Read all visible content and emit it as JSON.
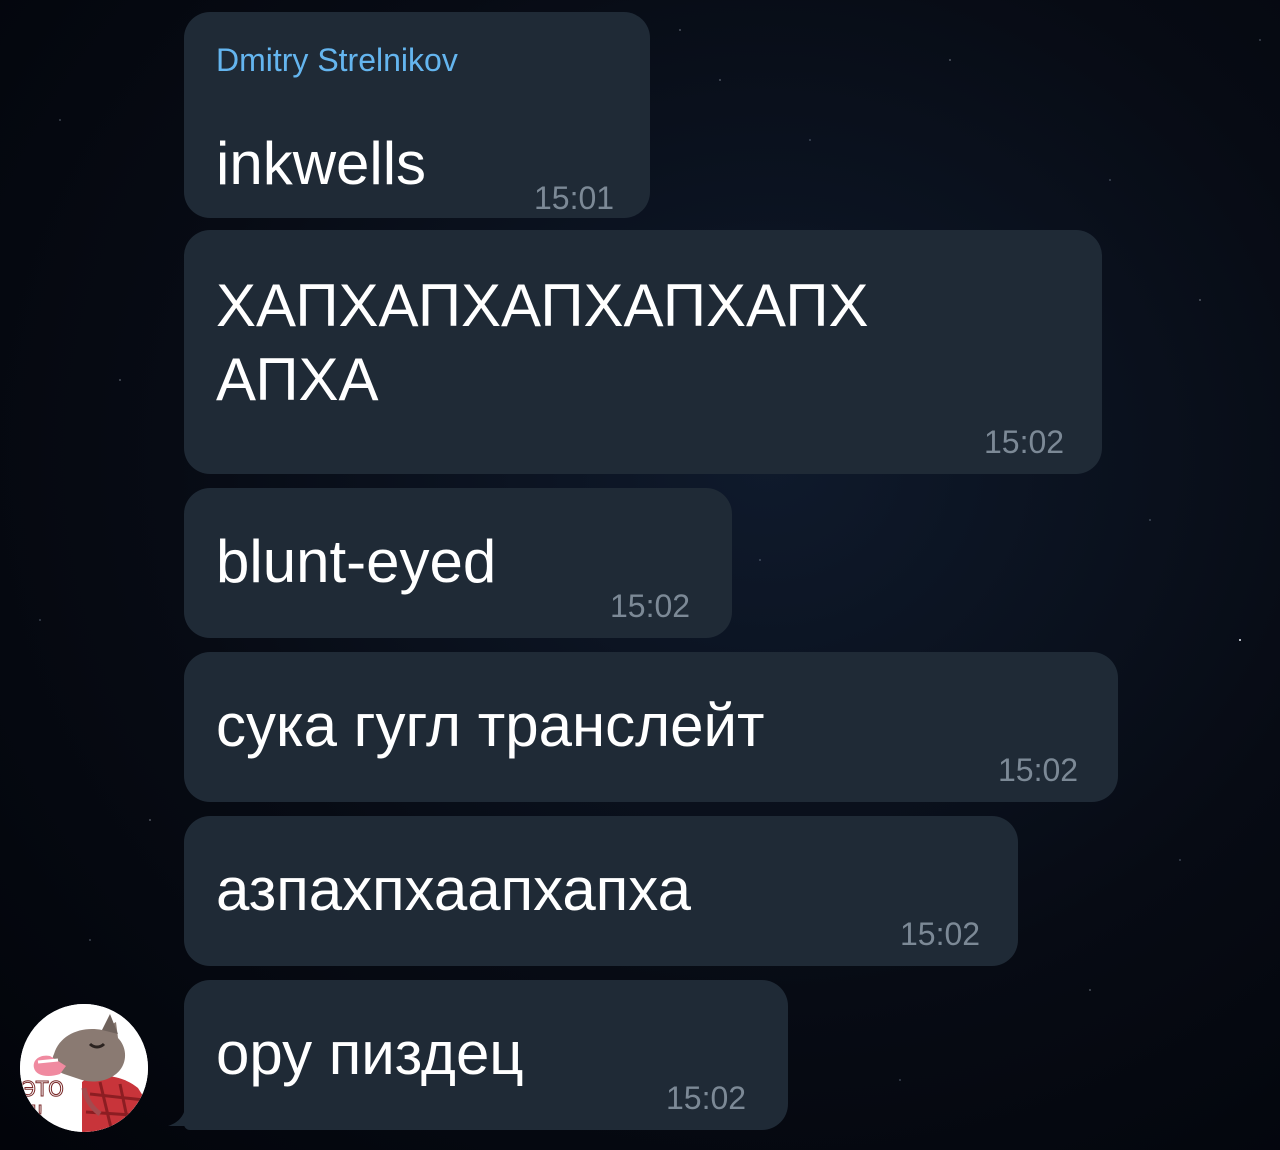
{
  "chat": {
    "sender_name": "Dmitry Strelnikov",
    "messages": [
      {
        "text": "inkwells",
        "time": "15:01"
      },
      {
        "line1": "ХАПХАПХАПХАПХАПХ",
        "line2": "АПХА",
        "time": "15:02"
      },
      {
        "text": "blunt-eyed",
        "time": "15:02"
      },
      {
        "text": "сука гугл транслейт",
        "time": "15:02"
      },
      {
        "text": "азпахпхаапхапха",
        "time": "15:02"
      },
      {
        "text": "ору пиздец",
        "time": "15:02"
      }
    ]
  },
  "avatar": {
    "label": "ЭТО Я!",
    "icon": "wolf-sticker-avatar"
  },
  "colors": {
    "bubble": "#1f2a36",
    "sender": "#64b5ef",
    "time": "#7c8996",
    "text": "#ffffff"
  }
}
